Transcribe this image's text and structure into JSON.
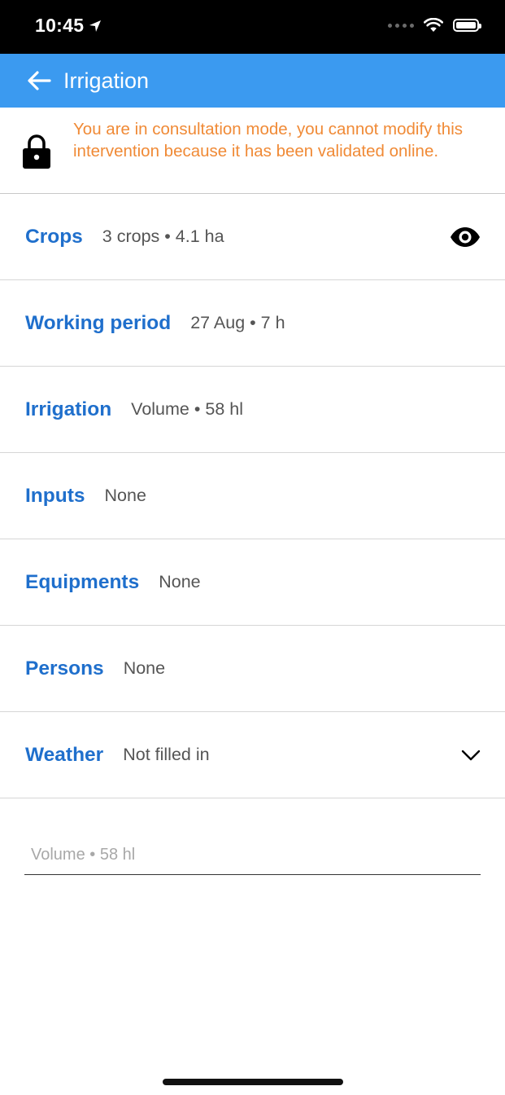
{
  "status_bar": {
    "time": "10:45",
    "icons": [
      "location-arrow-icon",
      "signal-dots-icon",
      "wifi-icon",
      "battery-icon"
    ]
  },
  "app_bar": {
    "title": "Irrigation",
    "back_icon": "arrow-left-icon",
    "background_color": "#3b9af0"
  },
  "notice": {
    "icon": "lock-icon",
    "text": "You are in consultation mode, you cannot modify this intervention because it has been validated online.",
    "color": "#f08a36"
  },
  "rows": [
    {
      "label": "Crops",
      "value": "3 crops • 4.1 ha",
      "trailing_icon": "eye-icon"
    },
    {
      "label": "Working period",
      "value": "27 Aug • 7 h"
    },
    {
      "label": "Irrigation",
      "value": "Volume • 58 hl"
    },
    {
      "label": "Inputs",
      "value": "None"
    },
    {
      "label": "Equipments",
      "value": "None"
    },
    {
      "label": "Persons",
      "value": "None"
    },
    {
      "label": "Weather",
      "value": "Not filled in",
      "trailing_icon": "chevron-down-icon"
    }
  ],
  "volume_field": {
    "placeholder": "Volume • 58 hl"
  },
  "colors": {
    "label": "#1f6fcc",
    "value": "#555555",
    "divider": "#d6d6d6"
  }
}
